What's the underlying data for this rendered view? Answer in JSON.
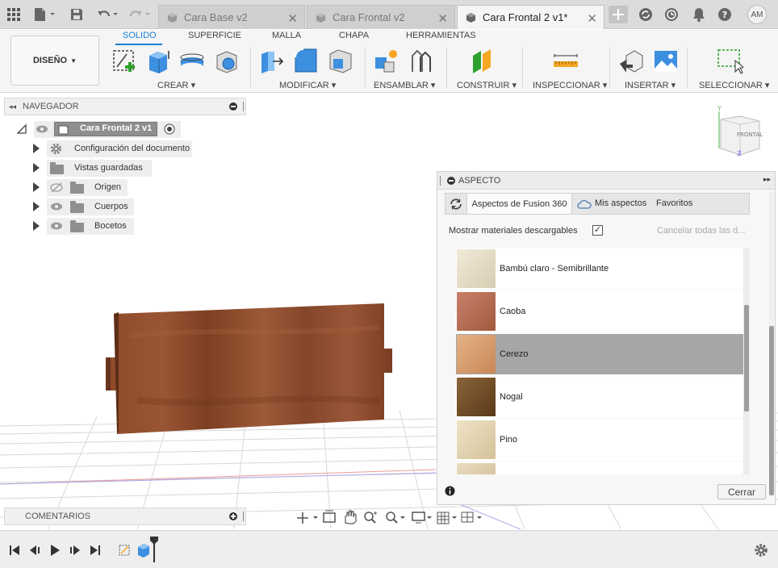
{
  "tabs": {
    "items": [
      {
        "label": "Cara Base v2"
      },
      {
        "label": "Cara Frontal v2"
      },
      {
        "label": "Cara Frontal 2 v1*"
      }
    ],
    "user_initials": "AM"
  },
  "ribbon": {
    "workspace": "DISEÑO",
    "tabs": [
      "SOLIDO",
      "SUPERFICIE",
      "MALLA",
      "CHAPA",
      "HERRAMIENTAS"
    ],
    "active_tab": "SOLIDO",
    "groups": [
      "CREAR",
      "MODIFICAR",
      "ENSAMBLAR",
      "CONSTRUIR",
      "INSPECCIONAR",
      "INSERTAR",
      "SELECCIONAR"
    ]
  },
  "navigator": {
    "title": "NAVEGADOR",
    "root": "Cara Frontal 2 v1",
    "items": [
      {
        "label": "Configuración del documento",
        "icon": "gear-icon"
      },
      {
        "label": "Vistas guardadas",
        "icon": "folder-icon"
      },
      {
        "label": "Origen",
        "icon": "folder-icon",
        "visibility": "hidden"
      },
      {
        "label": "Cuerpos",
        "icon": "folder-icon",
        "visibility": "visible"
      },
      {
        "label": "Bocetos",
        "icon": "folder-icon",
        "visibility": "visible"
      }
    ]
  },
  "viewcube": {
    "face": "FRONTAL"
  },
  "comments": {
    "title": "COMENTARIOS"
  },
  "aspecto": {
    "title": "ASPECTO",
    "tabs": [
      "Aspectos de Fusion 360",
      "Mis aspectos",
      "Favoritos"
    ],
    "show_downloadable_label": "Mostrar materiales descargables",
    "show_downloadable_checked": true,
    "cancel_downloads_label": "Cancelar todas las d...",
    "materials": [
      {
        "name": "Bambú claro - Semibrillante",
        "color": "#e6dcc4"
      },
      {
        "name": "Caoba",
        "color": "#b3694a"
      },
      {
        "name": "Cerezo",
        "color": "#d39868"
      },
      {
        "name": "Nogal",
        "color": "#6e4a25"
      },
      {
        "name": "Pino",
        "color": "#e3d3b2"
      }
    ],
    "selected_material": "Cerezo",
    "close_label": "Cerrar"
  },
  "colors": {
    "accent": "#1a7ed4",
    "board": "#8a4a2b",
    "selected_row": "#a6a6a6"
  }
}
